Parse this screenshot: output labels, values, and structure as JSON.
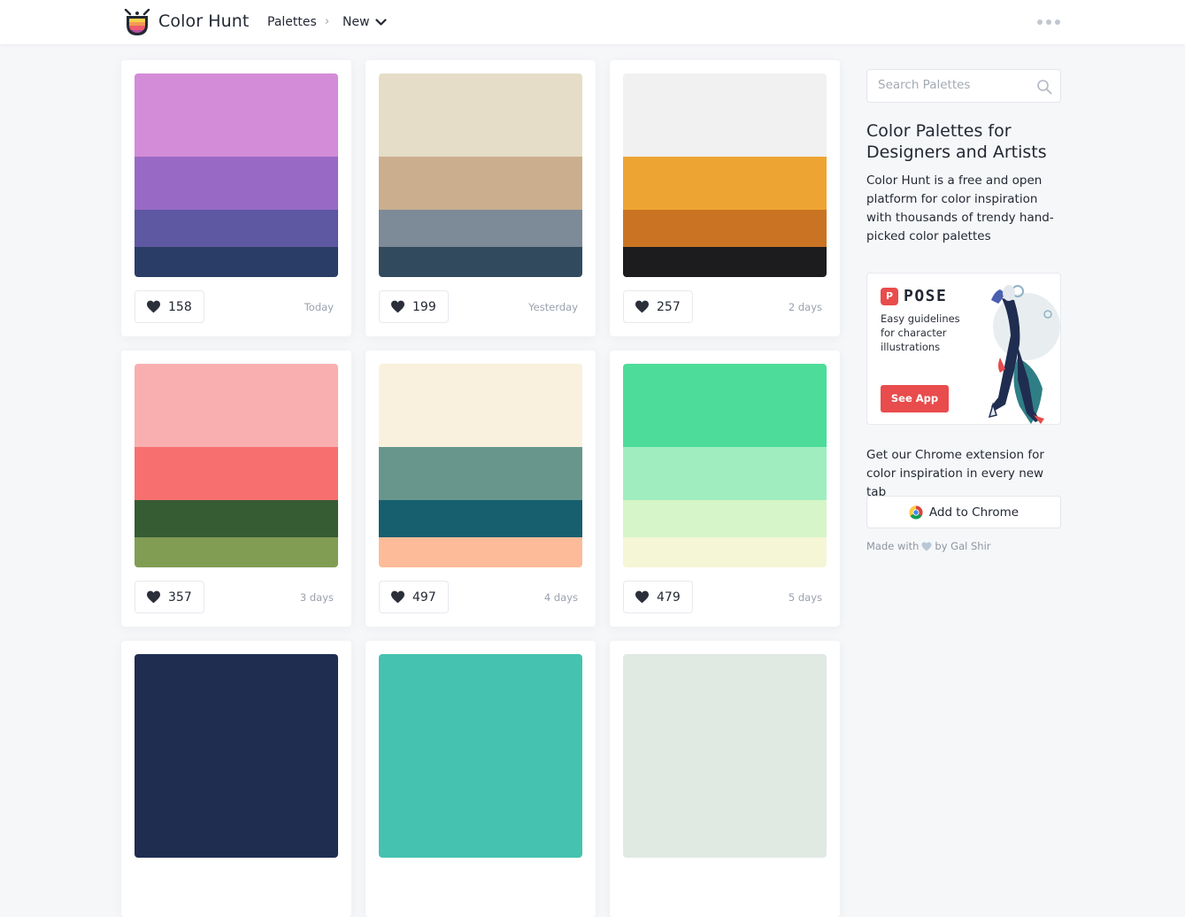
{
  "header": {
    "brand": "Color Hunt",
    "nav_palettes": "Palettes",
    "nav_separator": "›",
    "nav_new": "New"
  },
  "palettes": [
    {
      "colors": [
        "#D38CD7",
        "#996AC5",
        "#5E58A2",
        "#2A3D67"
      ],
      "likes": "158",
      "date": "Today"
    },
    {
      "colors": [
        "#E5DDC8",
        "#CBAE8E",
        "#7D8A97",
        "#314A5E"
      ],
      "likes": "199",
      "date": "Yesterday"
    },
    {
      "colors": [
        "#F1F1F1",
        "#EEA432",
        "#CA7423",
        "#1C1C1F"
      ],
      "likes": "257",
      "date": "2 days"
    },
    {
      "colors": [
        "#F9AFAF",
        "#F86F6F",
        "#365C33",
        "#819D54"
      ],
      "likes": "357",
      "date": "3 days"
    },
    {
      "colors": [
        "#F9F1DD",
        "#68968D",
        "#175F6F",
        "#FDBB99"
      ],
      "likes": "497",
      "date": "4 days"
    },
    {
      "colors": [
        "#4DDC9A",
        "#A0EEBF",
        "#D6F5C8",
        "#F5F6D6"
      ],
      "likes": "479",
      "date": "5 days"
    },
    {
      "colors": [
        "#1F2D50"
      ],
      "likes": "",
      "date": ""
    },
    {
      "colors": [
        "#46C2B0"
      ],
      "likes": "",
      "date": ""
    },
    {
      "colors": [
        "#E1E9E3"
      ],
      "likes": "",
      "date": ""
    }
  ],
  "sidebar": {
    "search_placeholder": "Search Palettes",
    "title": "Color Palettes for Designers and Artists",
    "description": "Color Hunt is a free and open platform for color inspiration with thousands of trendy hand-picked color palettes",
    "ad": {
      "logo_letter": "P",
      "logo_text": "POSE",
      "text": "Easy guidelines for character illustrations",
      "button": "See App"
    },
    "chrome_text": "Get our Chrome extension for color inspiration in every new tab",
    "chrome_button": "Add to Chrome",
    "made_with_prefix": "Made with",
    "made_with_suffix": "by Gal Shir"
  },
  "colors": {
    "accent_red": "#E84C4C",
    "heart": "#2B2F3A",
    "muted_text": "#9AA1AD"
  }
}
